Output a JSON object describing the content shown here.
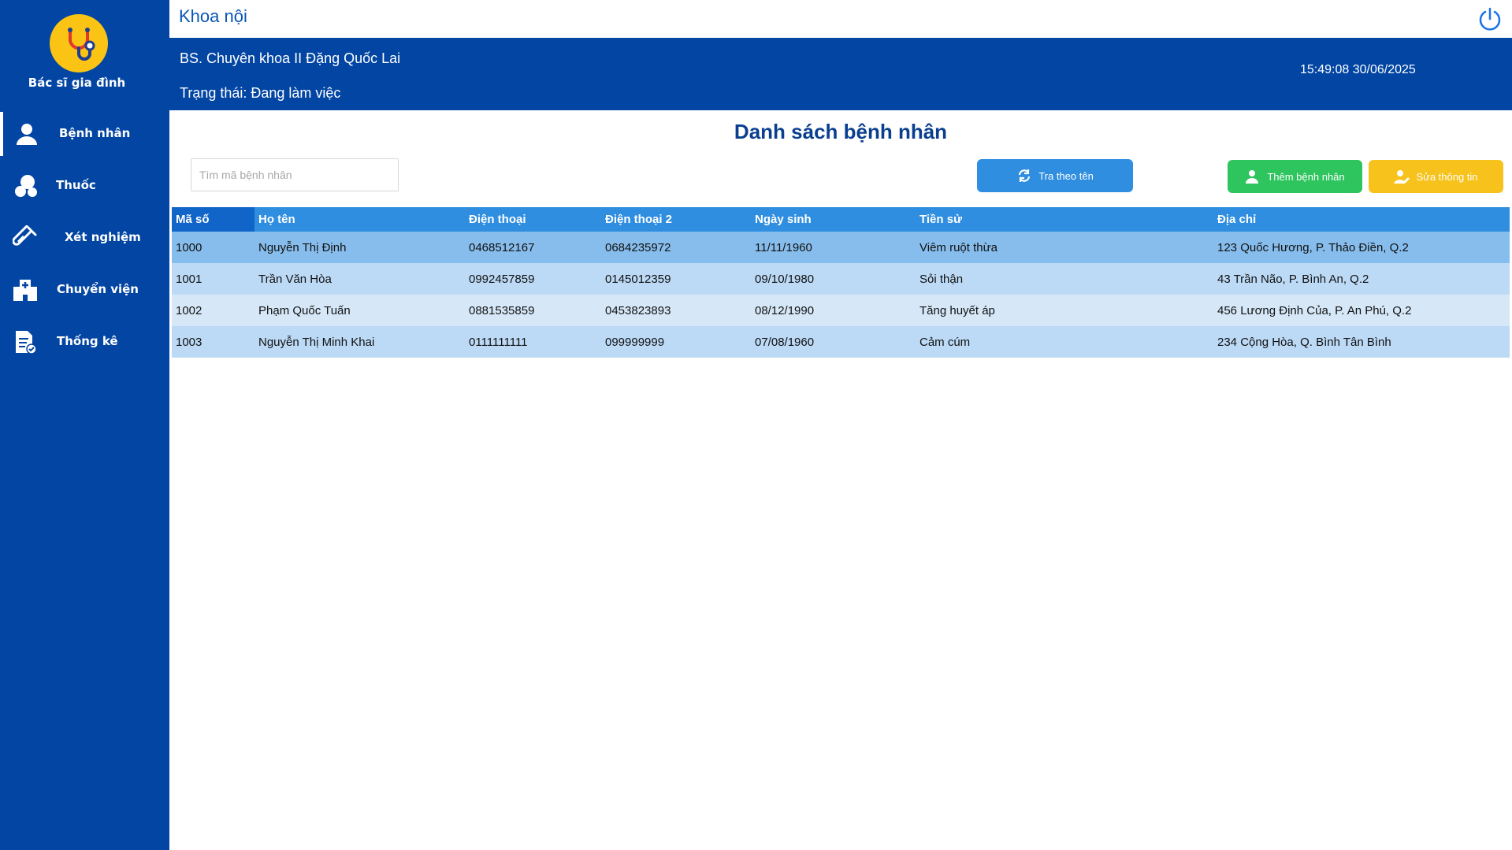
{
  "app": {
    "name": "Bác sĩ gia đình"
  },
  "sidebar": {
    "items": [
      {
        "label": "Bệnh nhân",
        "icon": "user-icon",
        "active": true
      },
      {
        "label": "Thuốc",
        "icon": "pills-icon",
        "active": false
      },
      {
        "label": "Xét nghiệm",
        "icon": "test-tube-icon",
        "active": false
      },
      {
        "label": "Chuyển viện",
        "icon": "hospital-icon",
        "active": false
      },
      {
        "label": "Thống kê",
        "icon": "report-icon",
        "active": false
      }
    ]
  },
  "header": {
    "department": "Khoa nội",
    "doctor": "BS. Chuyên khoa II Đặng Quốc Lai",
    "status": "Trạng thái: Đang làm việc",
    "datetime": "15:49:08 30/06/2025"
  },
  "main": {
    "title": "Danh sách bệnh nhân",
    "search_placeholder": "Tìm mã bệnh nhân",
    "search_button": "Tra theo tên",
    "add_button": "Thêm bệnh nhân",
    "edit_button": "Sửa thông tin"
  },
  "table": {
    "columns": [
      "Mã số",
      "Họ tên",
      "Điện thoại",
      "Điện thoại 2",
      "Ngày sinh",
      "Tiền sử",
      "Địa chỉ"
    ],
    "rows": [
      [
        "1000",
        "Nguyễn Thị Định",
        "0468512167",
        "0684235972",
        "11/11/1960",
        "Viêm ruột thừa",
        "123 Quốc Hương, P. Thảo Điền, Q.2"
      ],
      [
        "1001",
        "Trần Văn Hòa",
        "0992457859",
        "0145012359",
        "09/10/1980",
        "Sỏi thận",
        "43 Trần Não, P. Bình An, Q.2"
      ],
      [
        "1002",
        "Phạm Quốc Tuấn",
        "0881535859",
        "0453823893",
        "08/12/1990",
        "Tăng huyết áp",
        "456 Lương Định Của, P. An Phú, Q.2"
      ],
      [
        "1003",
        "Nguyễn Thị Minh Khai",
        "0111111111",
        "099999999",
        "07/08/1960",
        "Cảm cúm",
        "234 Cộng Hòa, Q. Bình Tân Bình"
      ]
    ]
  },
  "colors": {
    "primary": "#0245a3",
    "header_row": "#2f8ee0",
    "add": "#2ec45e",
    "edit": "#f6c21b",
    "logo": "#fbc414"
  }
}
